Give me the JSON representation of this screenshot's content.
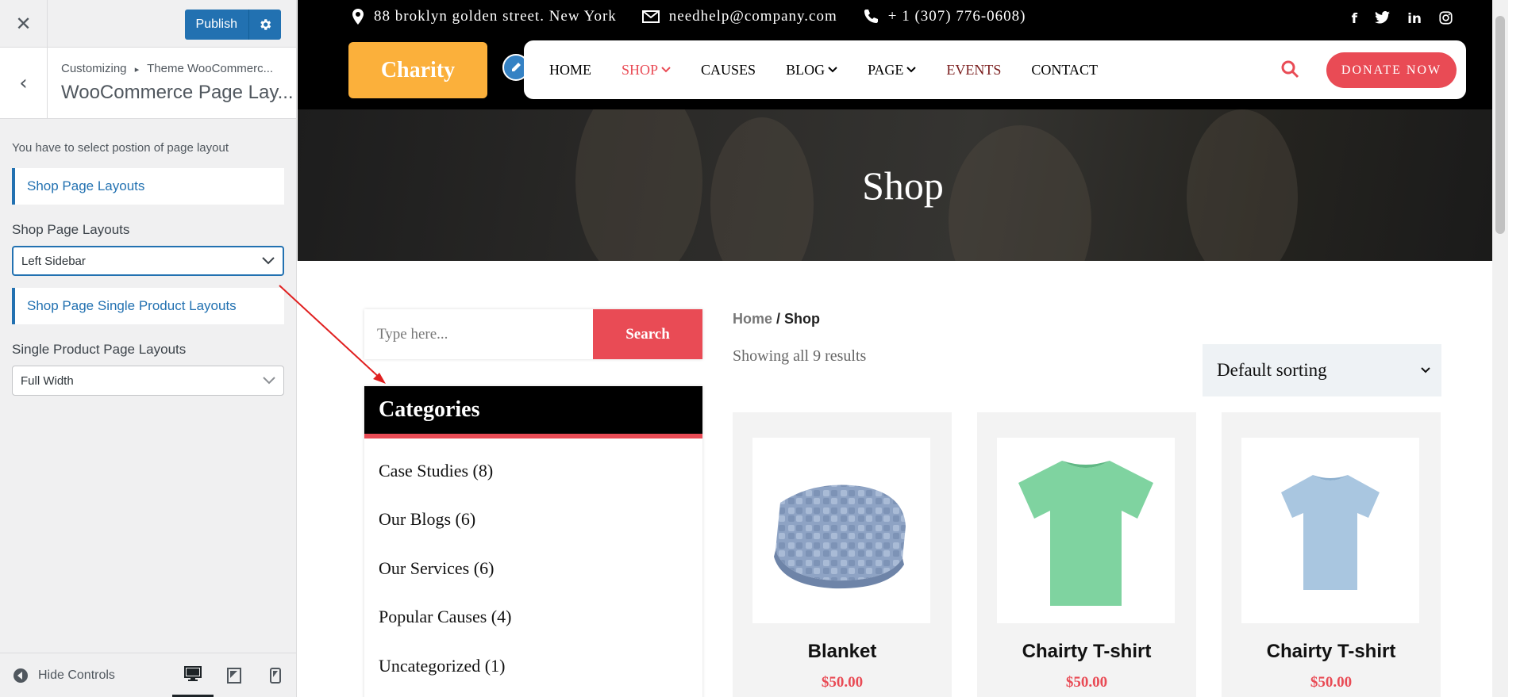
{
  "customizer": {
    "close_icon": "close-icon",
    "publish_label": "Publish",
    "breadcrumb_prefix": "Customizing",
    "breadcrumb_separator": "▸",
    "breadcrumb_section": "Theme WooCommerc...",
    "section_title": "WooCommerce Page Lay...",
    "description": "You have to select postion of page layout",
    "shop_heading": "Shop Page Layouts",
    "shop_label": "Shop Page Layouts",
    "shop_value": "Left Sidebar",
    "single_heading": "Shop Page Single Product Layouts",
    "single_label": "Single Product Page Layouts",
    "single_value": "Full Width",
    "hide_controls": "Hide Controls",
    "devices": [
      "desktop-icon",
      "tablet-icon",
      "mobile-icon"
    ]
  },
  "site": {
    "address": "88 broklyn golden street. New York",
    "email": "needhelp@company.com",
    "phone": "+ 1 (307) 776-0608)",
    "socials": [
      "f",
      "t",
      "in",
      "ig"
    ],
    "logo": "Charity",
    "nav": [
      "HOME",
      "SHOP",
      "CAUSES",
      "BLOG",
      "PAGE",
      "EVENTS",
      "CONTACT"
    ],
    "donate": "DONATE NOW",
    "banner_title": "Shop",
    "accent": "#e94b55",
    "logo_color": "#fbb03b"
  },
  "sidebar": {
    "search_placeholder": "Type here...",
    "search_button": "Search",
    "categories_title": "Categories",
    "categories": [
      "Case Studies (8)",
      "Our Blogs (6)",
      "Our Services (6)",
      "Popular Causes (4)",
      "Uncategorized (1)"
    ]
  },
  "shop": {
    "breadcrumb_home": "Home",
    "breadcrumb_sep": " / ",
    "breadcrumb_current": "Shop",
    "results": "Showing all 9 results",
    "sorting": "Default sorting",
    "products": [
      {
        "name": "Blanket",
        "price": "$50.00"
      },
      {
        "name": "Chairty T-shirt",
        "price": "$50.00"
      },
      {
        "name": "Chairty T-shirt",
        "price": "$50.00"
      }
    ]
  }
}
